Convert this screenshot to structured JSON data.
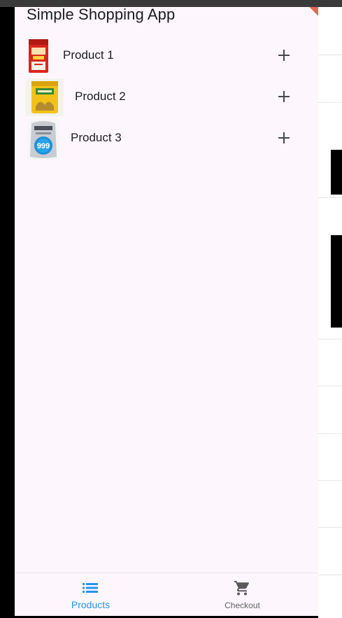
{
  "app": {
    "title": "Simple Shopping App"
  },
  "products": [
    {
      "name": "Product 1",
      "image_icon": "rice-bag-red-icon",
      "add_icon": "plus-icon"
    },
    {
      "name": "Product 2",
      "image_icon": "rice-bag-yellow-icon",
      "add_icon": "plus-icon"
    },
    {
      "name": "Product 3",
      "image_icon": "rice-bag-999-icon",
      "add_icon": "plus-icon"
    }
  ],
  "product3_bag_badge": "999",
  "bottom_nav": {
    "items": [
      {
        "label": "Products",
        "icon": "list-icon",
        "selected": true
      },
      {
        "label": "Checkout",
        "icon": "shopping-cart-icon",
        "selected": false
      }
    ]
  },
  "colors": {
    "background": "#fdf7fd",
    "accent": "#2196f3",
    "text": "#1d1b20",
    "icon": "#49454f",
    "debug_banner": "#e06a55"
  }
}
